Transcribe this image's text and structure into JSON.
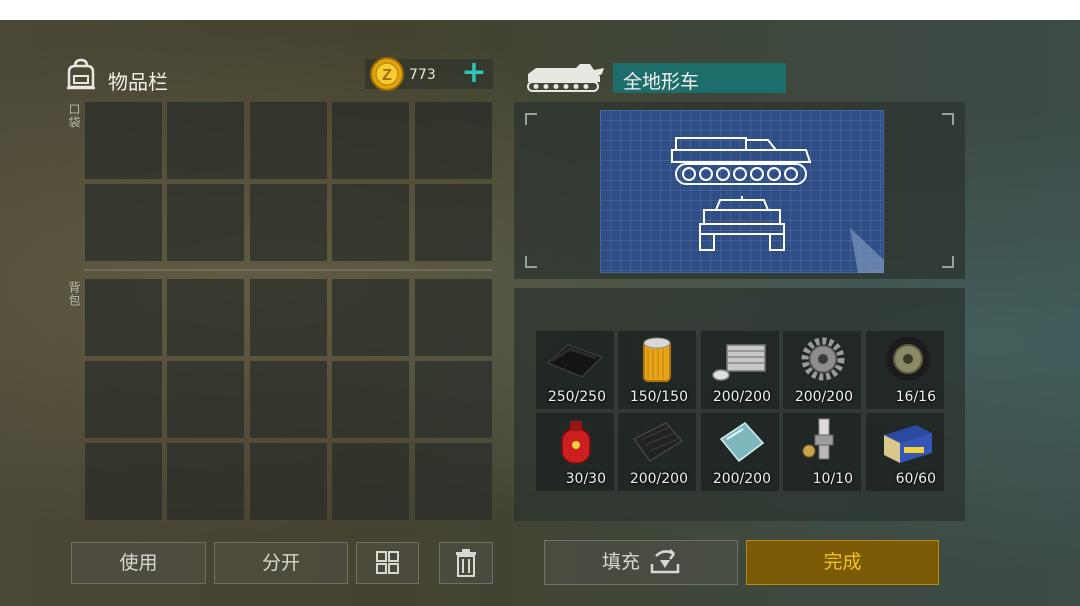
{
  "inventory": {
    "title": "物品栏",
    "coins": "773",
    "pockets_label": "口袋",
    "backpack_label": "背包"
  },
  "vehicle": {
    "name": "全地形车"
  },
  "parts": [
    {
      "icon": "tarp-icon",
      "count": "250/250"
    },
    {
      "icon": "air-filter-icon",
      "count": "150/150"
    },
    {
      "icon": "engine-block-icon",
      "count": "200/200"
    },
    {
      "icon": "gear-icon",
      "count": "200/200"
    },
    {
      "icon": "wheel-icon",
      "count": "16/16"
    },
    {
      "icon": "gas-cylinder-icon",
      "count": "30/30"
    },
    {
      "icon": "rubber-plate-icon",
      "count": "200/200"
    },
    {
      "icon": "glass-sheet-icon",
      "count": "200/200"
    },
    {
      "icon": "spark-plug-icon",
      "count": "10/10"
    },
    {
      "icon": "battery-icon",
      "count": "60/60"
    }
  ],
  "buttons": {
    "use": "使用",
    "split": "分开",
    "fill": "填充",
    "done": "完成"
  },
  "colors": {
    "accent_teal": "#2ec4b6",
    "done_gold": "#f7c21c",
    "vehicle_name_bg": "#1d6d6a"
  }
}
